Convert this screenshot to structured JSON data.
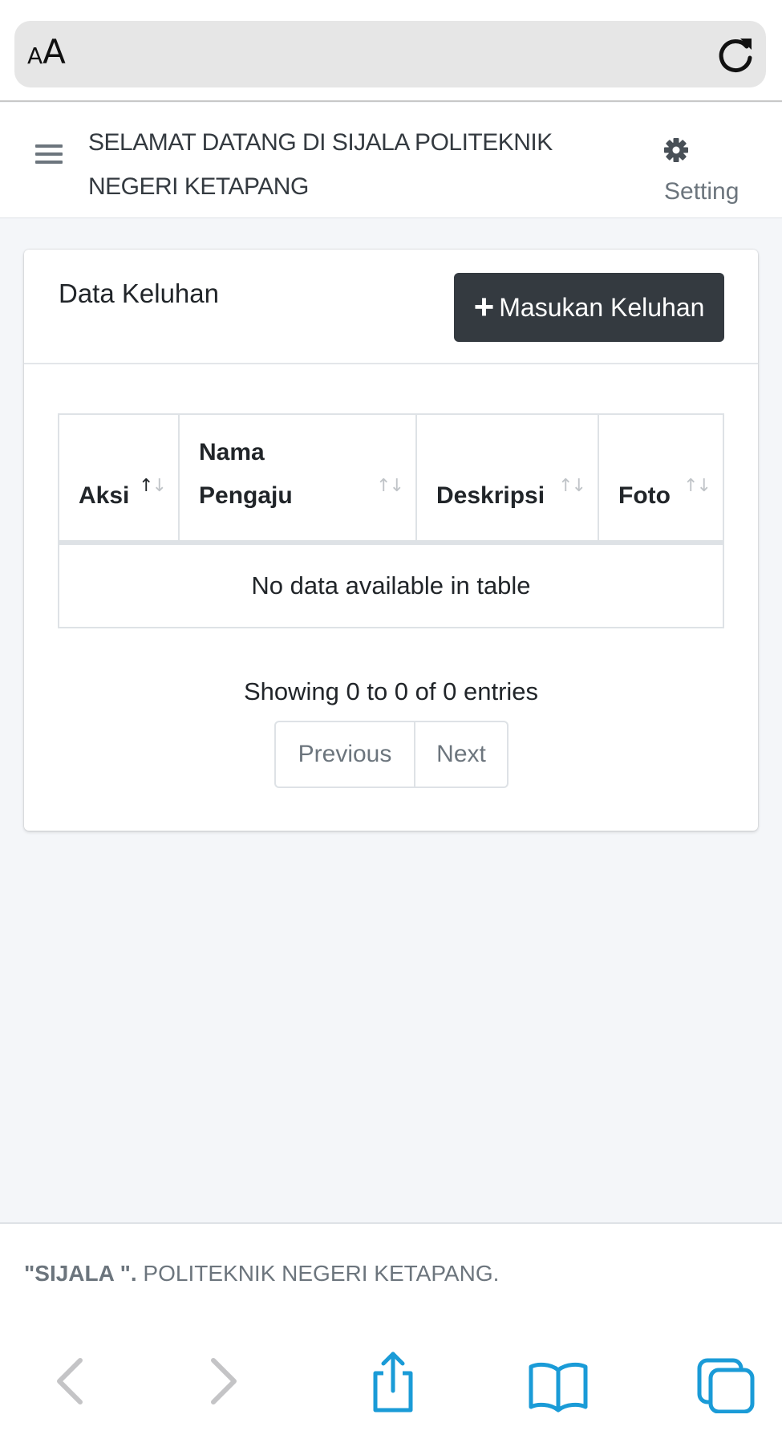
{
  "browser": {
    "aa_small": "A",
    "aa_big": "A",
    "reload_icon": "reload-icon",
    "bottom_icons": [
      "back-icon",
      "forward-icon",
      "share-icon",
      "bookmarks-icon",
      "tabs-icon"
    ],
    "accent_color": "#1a9bd7"
  },
  "navbar": {
    "title": "SELAMAT DATANG DI SIJALA POLITEKNIK NEGERI KETAPANG",
    "setting_label": "Setting"
  },
  "card": {
    "title": "Data Keluhan",
    "add_button_label": "Masukan Keluhan",
    "table": {
      "columns": [
        "Aksi",
        "Nama Pengaju",
        "Deskripsi",
        "Foto"
      ],
      "empty_message": "No data available in table"
    },
    "info": "Showing 0 to 0 of 0 entries",
    "pagination": {
      "previous": "Previous",
      "next": "Next"
    }
  },
  "footer": {
    "brand": "\"SIJALA \".",
    "text": " POLITEKNIK NEGERI KETAPANG."
  },
  "colors": {
    "button_dark": "#343a40",
    "page_bg": "#f4f6f9",
    "muted": "#6c757d"
  }
}
